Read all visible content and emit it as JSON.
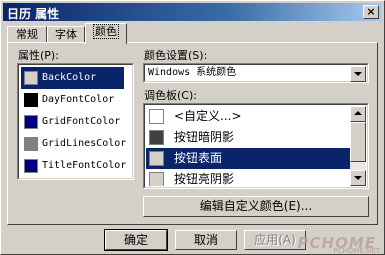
{
  "window": {
    "title": "日历 属性",
    "close_glyph": "×"
  },
  "tabs": [
    {
      "label": "常规"
    },
    {
      "label": "字体"
    },
    {
      "label": "颜色"
    }
  ],
  "properties": {
    "label": "属性(P):",
    "items": [
      {
        "name": "BackColor",
        "color": "#d4d0c8"
      },
      {
        "name": "DayFontColor",
        "color": "#000000"
      },
      {
        "name": "GridFontColor",
        "color": "#000080"
      },
      {
        "name": "GridLinesColor",
        "color": "#808080"
      },
      {
        "name": "TitleFontColor",
        "color": "#000080"
      }
    ],
    "selected_index": 0
  },
  "color_settings": {
    "label": "颜色设置(S):",
    "selected_value": "Windows 系统颜色"
  },
  "palette": {
    "label": "调色板(C):",
    "items": [
      {
        "name": "<自定义...>",
        "color": "#ffffff"
      },
      {
        "name": "按钮暗阴影",
        "color": "#404040"
      },
      {
        "name": "按钮表面",
        "color": "#d4d0c8"
      },
      {
        "name": "按钮亮阴影",
        "color": "#d4d0c8"
      }
    ],
    "selected_index": 2
  },
  "buttons": {
    "edit_custom": "编辑自定义颜色(E)...",
    "ok": "确定",
    "cancel": "取消",
    "apply": "应用(A)"
  },
  "watermark": {
    "main": "PCHOME",
    "sub": "PCHOME.NET"
  },
  "colors": {
    "selection": "#0a246a",
    "face": "#d4d0c8"
  }
}
